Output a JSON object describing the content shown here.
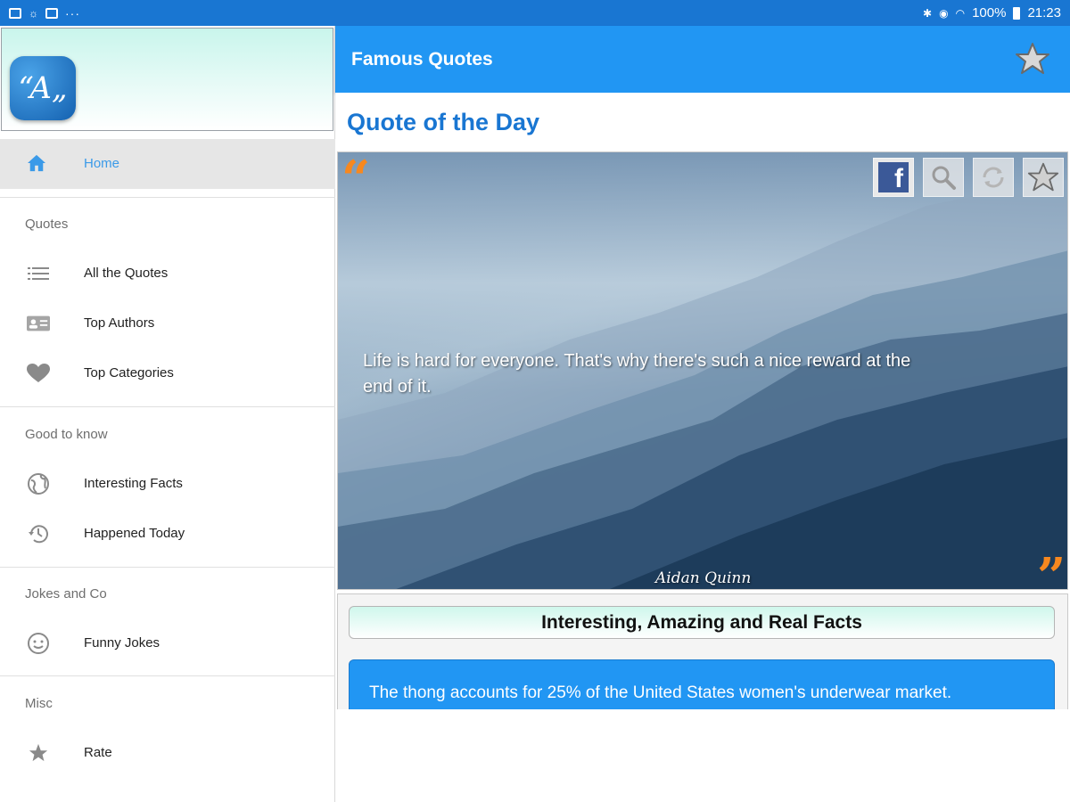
{
  "status_bar": {
    "battery": "100%",
    "time": "21:23",
    "dots": "···"
  },
  "drawer": {
    "logo_text": "“A„",
    "home": {
      "label": "Home"
    },
    "sections": [
      {
        "title": "Quotes",
        "items": [
          {
            "label": "All the Quotes",
            "icon": "list-icon"
          },
          {
            "label": "Top Authors",
            "icon": "contact-card-icon"
          },
          {
            "label": "Top Categories",
            "icon": "heart-icon"
          }
        ]
      },
      {
        "title": "Good to know",
        "items": [
          {
            "label": "Interesting Facts",
            "icon": "globe-icon"
          },
          {
            "label": "Happened Today",
            "icon": "history-icon"
          }
        ]
      },
      {
        "title": "Jokes and Co",
        "items": [
          {
            "label": "Funny Jokes",
            "icon": "smiley-icon"
          }
        ]
      },
      {
        "title": "Misc",
        "items": [
          {
            "label": "Rate",
            "icon": "star-icon"
          }
        ]
      }
    ]
  },
  "app_bar": {
    "title": "Famous Quotes"
  },
  "content": {
    "qotd_title": "Quote of the Day",
    "quote": {
      "text": "Life is hard for everyone. That's why there's such a nice reward at the end of it.",
      "author": "Aidan Quinn",
      "open_mark": "“",
      "close_mark": "”",
      "fb_letter": "f"
    },
    "facts": {
      "title": "Interesting, Amazing and Real Facts",
      "fact": "The thong accounts for 25% of the United States women's underwear market."
    }
  },
  "colors": {
    "primary": "#2196f3",
    "primary_dark": "#1976d2",
    "accent": "#f7881f"
  }
}
